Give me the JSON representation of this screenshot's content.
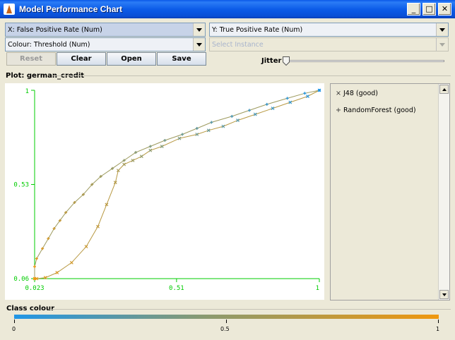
{
  "window": {
    "title": "Model Performance Chart"
  },
  "controls": {
    "x_axis": "X: False Positive Rate (Num)",
    "y_axis": "Y: True Positive Rate (Num)",
    "colour": "Colour: Threshold (Num)",
    "select_instance_placeholder": "Select Instance",
    "buttons": {
      "reset": "Reset",
      "clear": "Clear",
      "open": "Open",
      "save": "Save"
    },
    "jitter_label": "Jitter",
    "jitter_level": 0
  },
  "plot": {
    "label": "Plot: german_credit"
  },
  "legend": [
    {
      "marker": "×",
      "label": "J48 (good)"
    },
    {
      "marker": "+",
      "label": "RandomForest (good)"
    }
  ],
  "class_colour": {
    "label": "Class colour",
    "ticks": [
      "0",
      "0.5",
      "1"
    ],
    "gradient": [
      "#2196e6",
      "#8a9a70",
      "#f0980e"
    ]
  },
  "colors": {
    "axis": "#00cc00",
    "high_threshold": "#f0980e",
    "low_threshold": "#2196e6"
  },
  "chart_data": {
    "type": "line",
    "xlabel": "",
    "ylabel": "",
    "xlim": [
      0.023,
      1
    ],
    "ylim": [
      0.06,
      1
    ],
    "x_ticks": [
      "0.023",
      "0.51",
      "1"
    ],
    "y_ticks": [
      "0.06",
      "0.53",
      "1"
    ],
    "colour_by": "Threshold",
    "series": [
      {
        "name": "J48 (good)",
        "marker": "x",
        "points": [
          [
            0.023,
            0.06
          ],
          [
            0.03,
            0.06
          ],
          [
            0.06,
            0.065
          ],
          [
            0.1,
            0.09
          ],
          [
            0.15,
            0.14
          ],
          [
            0.2,
            0.22
          ],
          [
            0.24,
            0.32
          ],
          [
            0.27,
            0.43
          ],
          [
            0.3,
            0.54
          ],
          [
            0.31,
            0.6
          ],
          [
            0.33,
            0.63
          ],
          [
            0.36,
            0.65
          ],
          [
            0.39,
            0.67
          ],
          [
            0.42,
            0.7
          ],
          [
            0.46,
            0.72
          ],
          [
            0.52,
            0.76
          ],
          [
            0.58,
            0.78
          ],
          [
            0.62,
            0.8
          ],
          [
            0.67,
            0.82
          ],
          [
            0.72,
            0.85
          ],
          [
            0.78,
            0.88
          ],
          [
            0.84,
            0.91
          ],
          [
            0.9,
            0.94
          ],
          [
            0.96,
            0.97
          ],
          [
            1,
            1
          ]
        ]
      },
      {
        "name": "RandomForest (good)",
        "marker": "+",
        "points": [
          [
            0.023,
            0.06
          ],
          [
            0.023,
            0.12
          ],
          [
            0.03,
            0.16
          ],
          [
            0.05,
            0.21
          ],
          [
            0.07,
            0.26
          ],
          [
            0.09,
            0.31
          ],
          [
            0.11,
            0.35
          ],
          [
            0.13,
            0.39
          ],
          [
            0.16,
            0.44
          ],
          [
            0.19,
            0.48
          ],
          [
            0.22,
            0.53
          ],
          [
            0.25,
            0.57
          ],
          [
            0.29,
            0.61
          ],
          [
            0.33,
            0.65
          ],
          [
            0.37,
            0.69
          ],
          [
            0.42,
            0.72
          ],
          [
            0.47,
            0.75
          ],
          [
            0.53,
            0.78
          ],
          [
            0.58,
            0.81
          ],
          [
            0.63,
            0.84
          ],
          [
            0.7,
            0.87
          ],
          [
            0.76,
            0.9
          ],
          [
            0.82,
            0.93
          ],
          [
            0.89,
            0.96
          ],
          [
            0.95,
            0.985
          ],
          [
            1,
            1
          ]
        ]
      }
    ]
  }
}
